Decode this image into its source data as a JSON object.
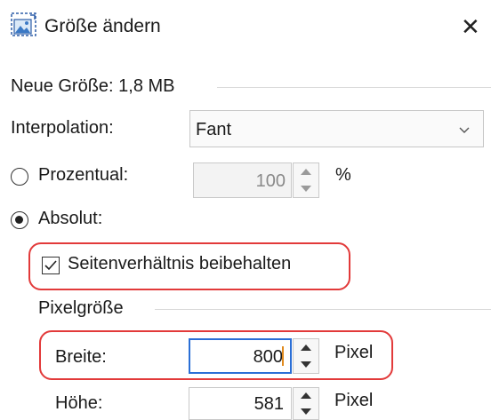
{
  "dialog": {
    "title": "Größe ändern",
    "close_glyph": "✕",
    "icon": "resize-image-icon"
  },
  "new_size": {
    "label": "Neue Größe: 1,8 MB"
  },
  "interpolation": {
    "label": "Interpolation:",
    "value": "Fant",
    "icon": "chevron-down-icon"
  },
  "percent": {
    "label": "Prozentual:",
    "value": "100",
    "unit": "%",
    "selected": false
  },
  "absolute": {
    "label": "Absolut:",
    "selected": true,
    "keep_ratio": {
      "label": "Seitenverhältnis beibehalten",
      "checked": true
    }
  },
  "pixel_size": {
    "label": "Pixelgröße",
    "width": {
      "label": "Breite:",
      "value": "800",
      "unit": "Pixel"
    },
    "height": {
      "label": "Höhe:",
      "value": "581",
      "unit": "Pixel"
    }
  },
  "colors": {
    "highlight": "#e23a3a",
    "focus": "#2b6fd6"
  }
}
